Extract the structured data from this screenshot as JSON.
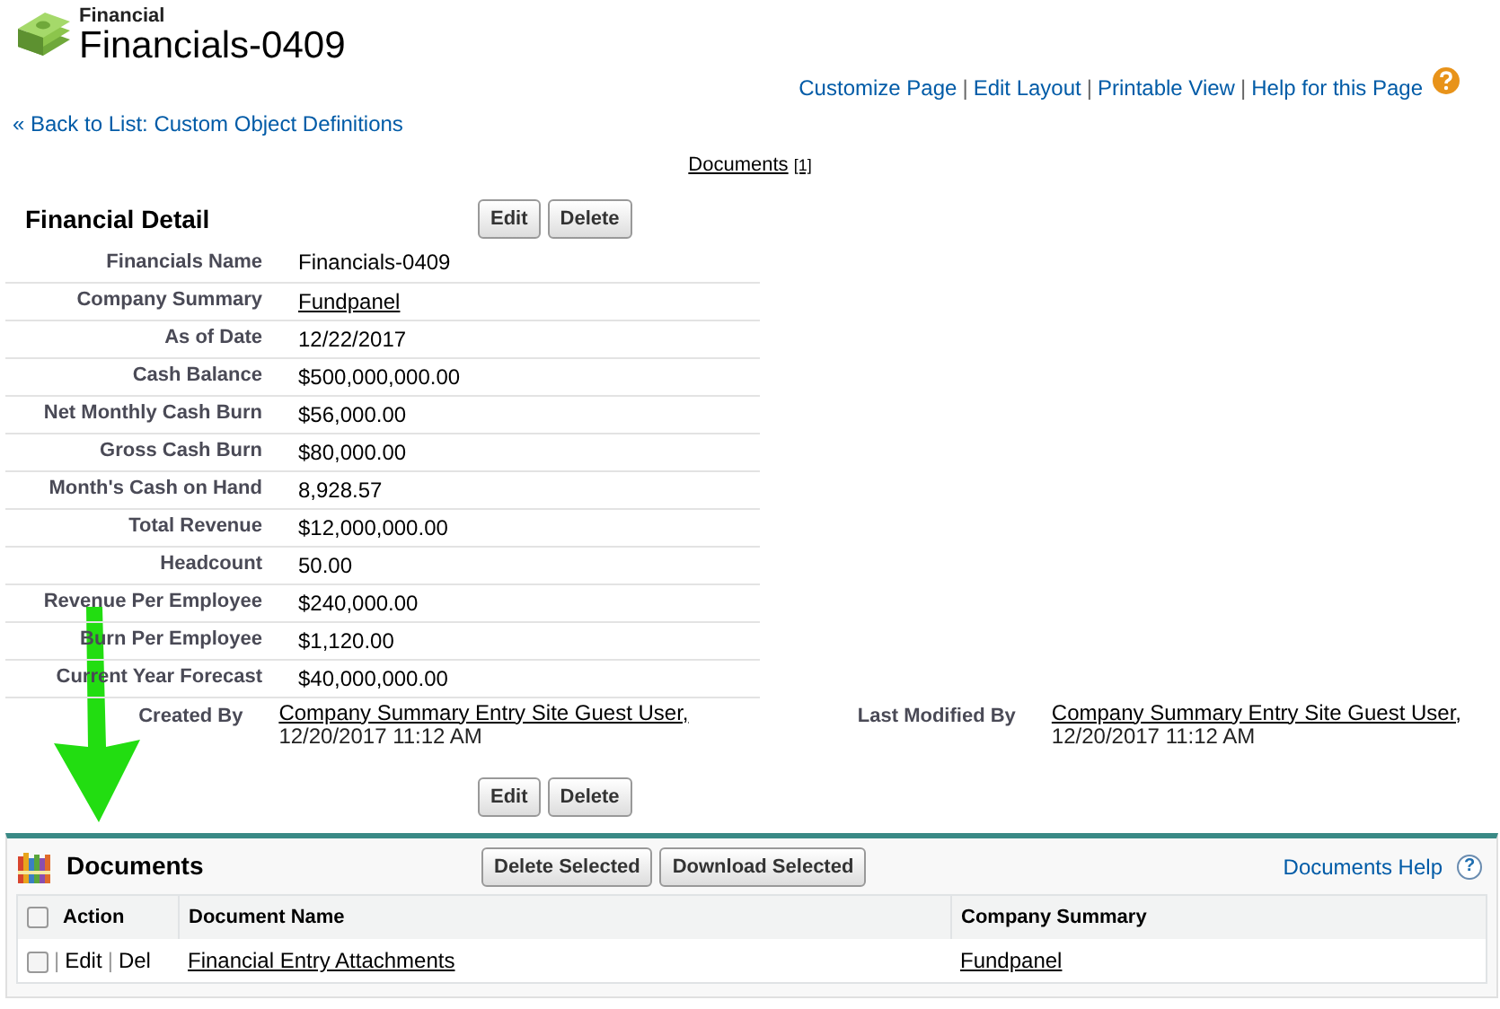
{
  "header": {
    "object_type": "Financial",
    "title": "Financials-0409"
  },
  "top_links": [
    "Customize Page",
    "Edit Layout",
    "Printable View",
    "Help for this Page"
  ],
  "link_separator": "|",
  "back_link": "« Back to List: Custom Object Definitions",
  "related_links": [
    {
      "label": "Documents",
      "count": "[1]"
    }
  ],
  "detail": {
    "title": "Financial Detail",
    "buttons": [
      "Edit",
      "Delete"
    ],
    "fields": [
      {
        "label": "Financials Name",
        "value": "Financials-0409",
        "kind": "text"
      },
      {
        "label": "Company Summary",
        "value": "Fundpanel",
        "kind": "link"
      },
      {
        "label": "As of Date",
        "value": "12/22/2017",
        "kind": "text"
      },
      {
        "label": "Cash Balance",
        "value": "$500,000,000.00",
        "kind": "text"
      },
      {
        "label": "Net Monthly Cash Burn",
        "value": "$56,000.00",
        "kind": "text"
      },
      {
        "label": "Gross Cash Burn",
        "value": "$80,000.00",
        "kind": "text"
      },
      {
        "label": "Month's Cash on Hand",
        "value": "8,928.57",
        "kind": "text"
      },
      {
        "label": "Total Revenue",
        "value": "$12,000,000.00",
        "kind": "text"
      },
      {
        "label": "Headcount",
        "value": "50.00",
        "kind": "text"
      },
      {
        "label": "Revenue Per Employee",
        "value": "$240,000.00",
        "kind": "text"
      },
      {
        "label": "Burn Per Employee",
        "value": "$1,120.00",
        "kind": "text"
      },
      {
        "label": "Current Year Forecast",
        "value": "$40,000,000.00",
        "kind": "text"
      }
    ],
    "audit": [
      {
        "label": "Created By",
        "user": "Company Summary Entry Site Guest User,",
        "date": "12/20/2017 11:12 AM"
      },
      {
        "label": "Last Modified By",
        "user": "Company Summary Entry Site Guest User,",
        "date": "12/20/2017 11:12 AM"
      }
    ],
    "bottom_buttons": [
      "Edit",
      "Delete"
    ]
  },
  "documents": {
    "title": "Documents",
    "buttons": [
      "Delete Selected",
      "Download Selected"
    ],
    "help": "Documents Help",
    "help_icon": "?",
    "columns": [
      "Action",
      "Document Name",
      "Company Summary"
    ],
    "header_checked": false,
    "rows": [
      {
        "checked": false,
        "actions": [
          "Edit",
          "Del"
        ],
        "document_name": "Financial Entry Attachments",
        "company_summary": "Fundpanel"
      }
    ]
  }
}
